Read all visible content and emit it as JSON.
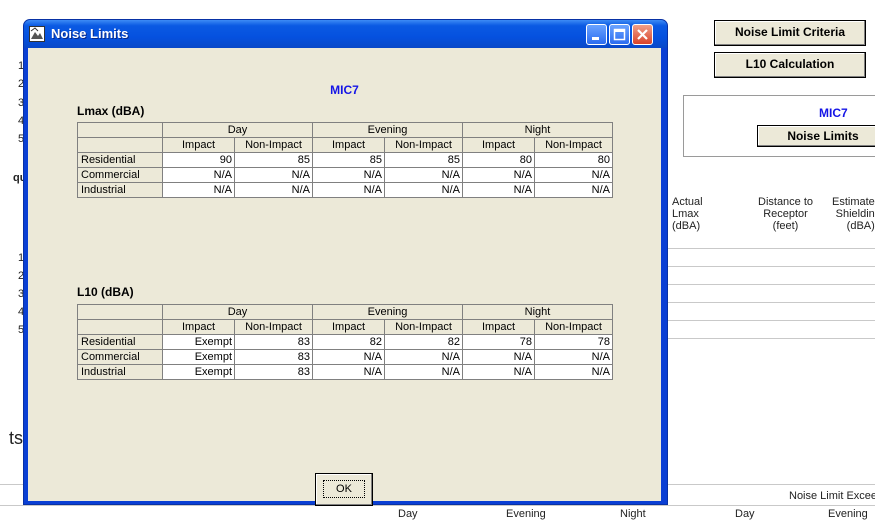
{
  "background": {
    "buttons": {
      "noise_limit_criteria": "Noise Limit Criteria",
      "l10_calculation": "L10 Calculation",
      "noise_limits": "Noise Limits"
    },
    "mic_label": "MIC7",
    "row_numbers_top": [
      "1",
      "2",
      "3",
      "4",
      "5"
    ],
    "row_numbers_bottom": [
      "1",
      "2",
      "3",
      "4",
      "5"
    ],
    "qu_fragment": "qu",
    "ts_fragment": "ts",
    "columns": {
      "actual_lmax": "Actual\nLmax\n(dBA)",
      "distance": "Distance to\nReceptor\n(feet)",
      "shielding": "Estimate\nShieldin\n(dBA)"
    },
    "footer": {
      "noise_limit_exceed": "Noise Limit Exceed",
      "day1": "Day",
      "evening1": "Evening",
      "night": "Night",
      "day2": "Day",
      "evening2": "Evening"
    }
  },
  "dialog": {
    "title": "Noise Limits",
    "mic": "MIC7",
    "ok_label": "OK",
    "lmax": {
      "label": "Lmax (dBA)",
      "periods": [
        "Day",
        "Evening",
        "Night"
      ],
      "subheaders": [
        "Impact",
        "Non-Impact",
        "Impact",
        "Non-Impact",
        "Impact",
        "Non-Impact"
      ],
      "rows": [
        {
          "label": "Residential",
          "values": [
            "90",
            "85",
            "85",
            "85",
            "80",
            "80"
          ]
        },
        {
          "label": "Commercial",
          "values": [
            "N/A",
            "N/A",
            "N/A",
            "N/A",
            "N/A",
            "N/A"
          ]
        },
        {
          "label": "Industrial",
          "values": [
            "N/A",
            "N/A",
            "N/A",
            "N/A",
            "N/A",
            "N/A"
          ]
        }
      ]
    },
    "l10": {
      "label": "L10 (dBA)",
      "periods": [
        "Day",
        "Evening",
        "Night"
      ],
      "subheaders": [
        "Impact",
        "Non-Impact",
        "Impact",
        "Non-Impact",
        "Impact",
        "Non-Impact"
      ],
      "rows": [
        {
          "label": "Residential",
          "values": [
            "Exempt",
            "83",
            "82",
            "82",
            "78",
            "78"
          ]
        },
        {
          "label": "Commercial",
          "values": [
            "Exempt",
            "83",
            "N/A",
            "N/A",
            "N/A",
            "N/A"
          ]
        },
        {
          "label": "Industrial",
          "values": [
            "Exempt",
            "83",
            "N/A",
            "N/A",
            "N/A",
            "N/A"
          ]
        }
      ]
    }
  }
}
